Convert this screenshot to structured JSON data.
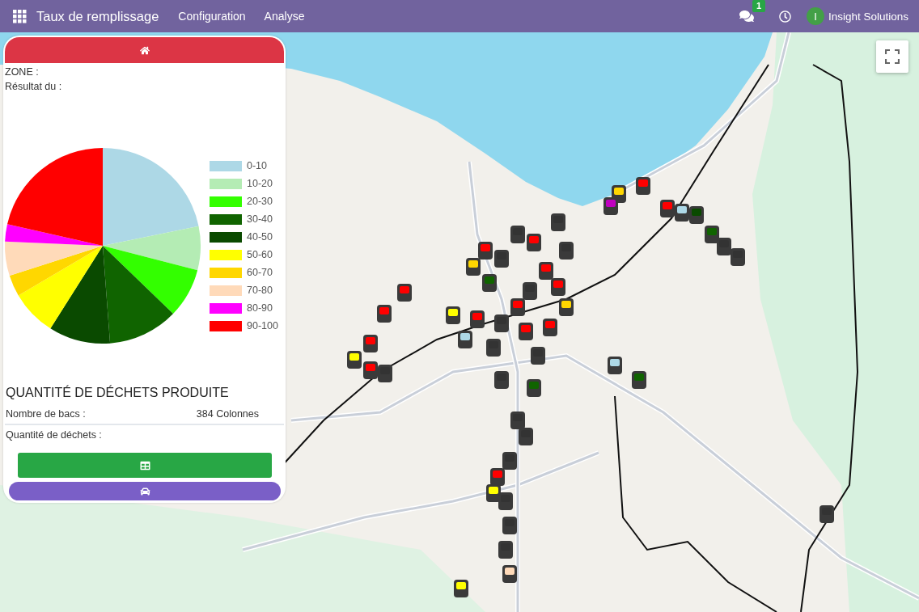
{
  "navbar": {
    "title": "Taux de remplissage",
    "menu": [
      {
        "label": "Configuration"
      },
      {
        "label": "Analyse"
      }
    ],
    "messages_badge": "1",
    "user": {
      "initial": "I",
      "name": "Insight Solutions"
    }
  },
  "panel": {
    "zone_label": "ZONE :",
    "result_label": "Résultat du :",
    "legend": [
      {
        "label": "0-10",
        "color": "#add8e6"
      },
      {
        "label": "10-20",
        "color": "#b4ecb4"
      },
      {
        "label": "20-30",
        "color": "#33ff00"
      },
      {
        "label": "30-40",
        "color": "#106400"
      },
      {
        "label": "40-50",
        "color": "#0a4a00"
      },
      {
        "label": "50-60",
        "color": "#ffff00"
      },
      {
        "label": "60-70",
        "color": "#ffd700"
      },
      {
        "label": "70-80",
        "color": "#ffdab9"
      },
      {
        "label": "80-90",
        "color": "#ff00ff"
      },
      {
        "label": "90-100",
        "color": "#ff0000"
      }
    ],
    "section_title": "QUANTITÉ DE DÉCHETS PRODUITE",
    "stats": [
      {
        "label": "Nombre de bacs :",
        "value": "384 Colonnes"
      },
      {
        "label": "Quantité de déchets :"
      }
    ]
  }
}
